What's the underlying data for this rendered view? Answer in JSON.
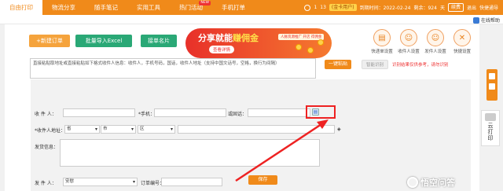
{
  "nav": {
    "items": [
      {
        "label": "自由打印",
        "active": true
      },
      {
        "label": "物流分享"
      },
      {
        "label": "随手笔记"
      },
      {
        "label": "实用工具"
      },
      {
        "label": "热门活动",
        "badge": "NEW"
      },
      {
        "label": "手机打单"
      }
    ],
    "account": "1",
    "account_suffix": "13",
    "member": "(金卡用户)",
    "expiry": "到期时间：2022-02-24",
    "balance": "剩余：924",
    "balance_unit": "天",
    "renew": "续费",
    "logout": "退出",
    "shortcut": "快捷通导"
  },
  "subbar": {
    "cs_label": "在线帮助"
  },
  "actions": {
    "new_order": "+新建订单",
    "import_excel": "批量导入Excel",
    "grab_card": "接单名片"
  },
  "banner": {
    "headline_a": "分享就能",
    "headline_b": "赚佣金",
    "cta": "查看详情",
    "tag": "人脉资源推广 开店 得佣金"
  },
  "quick_icons": [
    {
      "label": "快递单设置",
      "icon": "printer-icon"
    },
    {
      "label": "收件人设置",
      "icon": "user-icon"
    },
    {
      "label": "发件人设置",
      "icon": "user-icon"
    },
    {
      "label": "快捷设置",
      "icon": "tools-icon"
    }
  ],
  "form": {
    "paste_text": "直接粘贴取地址或直接粘贴如下格式收件人信息：收件人，手机号码，国话，收件人地址（支持中国文话号，空格，换行为间隔）",
    "parse_btn": "一键粘贴",
    "sense_btn": "智能识别",
    "hint": "识别结果仅供参考，请勿识别",
    "receiver_label": "收 件 人：",
    "mobile_label": "*手机：",
    "tel_label": "或固话：",
    "address_label": "*收件人地址：",
    "province": "省",
    "city": "市",
    "district": "区",
    "info_label": "发货信息：",
    "sender_label": "发 件 人：",
    "sender_value": "安慰",
    "order_no_label": "订单编号：",
    "save_btn": "保存"
  },
  "side": {
    "print_line1": "云",
    "print_line2": "打",
    "print_line3": "印"
  },
  "watermark": "悟空问答"
}
